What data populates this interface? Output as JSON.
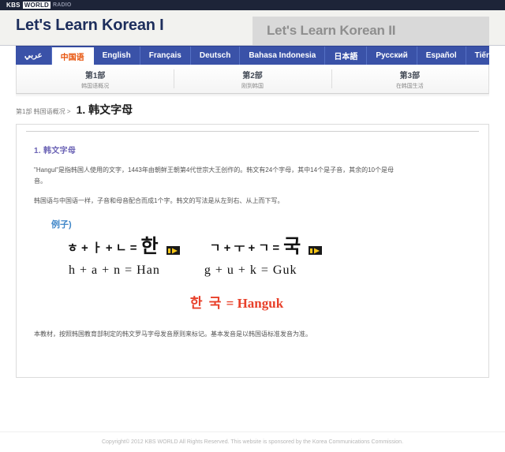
{
  "brand": {
    "kbs": "KBS",
    "world": "WORLD",
    "radio": "RADIO"
  },
  "header": {
    "title": "Let's Learn Korean I",
    "alt_title": "Let's Learn Korean II"
  },
  "language_tabs": [
    {
      "label": "عربي",
      "active": false,
      "rtl": true
    },
    {
      "label": "中国语",
      "active": true,
      "rtl": false
    },
    {
      "label": "English",
      "active": false,
      "rtl": false
    },
    {
      "label": "Français",
      "active": false,
      "rtl": false
    },
    {
      "label": "Deutsch",
      "active": false,
      "rtl": false
    },
    {
      "label": "Bahasa Indonesia",
      "active": false,
      "rtl": false
    },
    {
      "label": "日本語",
      "active": false,
      "rtl": false
    },
    {
      "label": "Русский",
      "active": false,
      "rtl": false
    },
    {
      "label": "Español",
      "active": false,
      "rtl": false
    },
    {
      "label": "Tiếng Việt",
      "active": false,
      "rtl": false
    }
  ],
  "parts": [
    {
      "title": "第1部",
      "sub": "韩国语概况"
    },
    {
      "title": "第2部",
      "sub": "刚到韩国"
    },
    {
      "title": "第3部",
      "sub": "在韩国生活"
    }
  ],
  "breadcrumb": {
    "path": "第1部 韩国语概况 >",
    "page_title": "1. 韩文字母"
  },
  "content": {
    "section_title": "1. 韩文字母",
    "paragraph_1": "\"Hangul\"是指韩国人使用的文字，1443年由朝鲜王朝第4代世宗大王创作的。韩文有24个字母，其中14个是子音，其余的10个是母音。",
    "paragraph_2": "韩国语与中国语一样，子音和母音配合而成1个字。韩文的写法是从左到右、从上而下写。",
    "example_label": "例子)",
    "examples": [
      {
        "parts": "ㅎ + ㅏ + ㄴ =",
        "result": "한",
        "audio_icon": "play-icon",
        "romanized": "h + a + n = Han"
      },
      {
        "parts": "ㄱ + ㅜ + ㄱ =",
        "result": "국",
        "audio_icon": "play-icon",
        "romanized": "g + u + k = Guk"
      }
    ],
    "combined_hangul": "한 국",
    "combined_equals": "=",
    "combined_romanized": "Hanguk",
    "footnote": "本教材，按照韩国教育部制定的韩文罗马字母发音原则来标记。基本发音是以韩国语标准发音为准。"
  },
  "footer": {
    "copyright": "Copyright© 2012 KBS WORLD All Rights Reserved. This website is sponsored by the Korea Communications Commission."
  },
  "colors": {
    "topbar": "#1d2438",
    "tab_bar": "#3a52a8",
    "tab_active_text": "#e8560f",
    "title": "#1d2e5c",
    "section_title": "#6b63b5",
    "example_label": "#3f86c8",
    "result_red": "#e8402a"
  }
}
